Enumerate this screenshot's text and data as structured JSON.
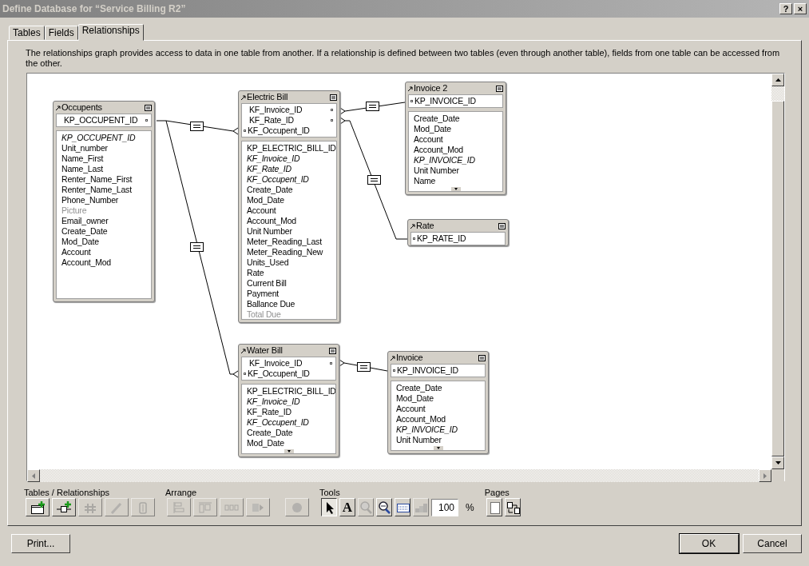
{
  "window": {
    "title": "Define Database for “Service Billing R2”",
    "help_button": "?",
    "close_button": "×"
  },
  "tabs": [
    {
      "label": "Tables",
      "selected": false
    },
    {
      "label": "Fields",
      "selected": false
    },
    {
      "label": "Relationships",
      "selected": true
    }
  ],
  "description": "The relationships graph provides access to data in one table from another. If a relationship is defined between two tables (even through another table), fields from one table can be accessed from the other.",
  "tables": [
    {
      "name": "Occupents",
      "keys": [
        {
          "name": "KP_OCCUPENT_ID",
          "kind": "right-dot"
        }
      ],
      "fields": [
        {
          "name": "KP_OCCUPENT_ID",
          "kind": "italic"
        },
        {
          "name": "Unit_number",
          "kind": "normal"
        },
        {
          "name": "Name_First",
          "kind": "normal"
        },
        {
          "name": "Name_Last",
          "kind": "normal"
        },
        {
          "name": "Renter_Name_First",
          "kind": "normal"
        },
        {
          "name": "Renter_Name_Last",
          "kind": "normal"
        },
        {
          "name": "Phone_Number",
          "kind": "normal"
        },
        {
          "name": "Picture",
          "kind": "dim"
        },
        {
          "name": "Email_owner",
          "kind": "normal"
        },
        {
          "name": "Create_Date",
          "kind": "normal"
        },
        {
          "name": "Mod_Date",
          "kind": "normal"
        },
        {
          "name": "Account",
          "kind": "normal"
        },
        {
          "name": "Account_Mod",
          "kind": "normal"
        }
      ]
    },
    {
      "name": "Electric Bill",
      "keys": [
        {
          "name": "KF_Invoice_ID",
          "kind": "right-dot"
        },
        {
          "name": "KF_Rate_ID",
          "kind": "right-dot"
        },
        {
          "name": "KF_Occupent_ID",
          "kind": "left-dot"
        }
      ],
      "fields": [
        {
          "name": "KP_ELECTRIC_BILL_ID",
          "kind": "normal"
        },
        {
          "name": "KF_Invoice_ID",
          "kind": "italic"
        },
        {
          "name": "KF_Rate_ID",
          "kind": "italic"
        },
        {
          "name": "KF_Occupent_ID",
          "kind": "italic"
        },
        {
          "name": "Create_Date",
          "kind": "normal"
        },
        {
          "name": "Mod_Date",
          "kind": "normal"
        },
        {
          "name": "Account",
          "kind": "normal"
        },
        {
          "name": "Account_Mod",
          "kind": "normal"
        },
        {
          "name": "Unit Number",
          "kind": "normal"
        },
        {
          "name": "Meter_Reading_Last",
          "kind": "normal"
        },
        {
          "name": "Meter_Reading_New",
          "kind": "normal"
        },
        {
          "name": "Units_Used",
          "kind": "normal"
        },
        {
          "name": "Rate",
          "kind": "normal"
        },
        {
          "name": "Current Bill",
          "kind": "normal"
        },
        {
          "name": "Payment",
          "kind": "normal"
        },
        {
          "name": "Ballance Due",
          "kind": "normal"
        },
        {
          "name": "Total Due",
          "kind": "dim"
        }
      ]
    },
    {
      "name": "Invoice 2",
      "keys": [
        {
          "name": "KP_INVOICE_ID",
          "kind": "left-dot"
        }
      ],
      "truncated": true,
      "fields": [
        {
          "name": "Create_Date",
          "kind": "normal"
        },
        {
          "name": "Mod_Date",
          "kind": "normal"
        },
        {
          "name": "Account",
          "kind": "normal"
        },
        {
          "name": "Account_Mod",
          "kind": "normal"
        },
        {
          "name": "KP_INVOICE_ID",
          "kind": "italic"
        },
        {
          "name": "Unit Number",
          "kind": "normal"
        },
        {
          "name": "Name",
          "kind": "normal"
        }
      ]
    },
    {
      "name": "Rate",
      "keys": [
        {
          "name": "KP_RATE_ID",
          "kind": "left-dot"
        }
      ]
    },
    {
      "name": "Water Bill",
      "keys": [
        {
          "name": "KF_Invoice_ID",
          "kind": "right-dot"
        },
        {
          "name": "KF_Occupent_ID",
          "kind": "left-dot"
        }
      ],
      "truncated": true,
      "fields": [
        {
          "name": "KP_ELECTRIC_BILL_ID",
          "kind": "normal"
        },
        {
          "name": "KF_Invoice_ID",
          "kind": "italic"
        },
        {
          "name": "KF_Rate_ID",
          "kind": "normal"
        },
        {
          "name": "KF_Occupent_ID",
          "kind": "italic"
        },
        {
          "name": "Create_Date",
          "kind": "normal"
        },
        {
          "name": "Mod_Date",
          "kind": "normal"
        }
      ]
    },
    {
      "name": "Invoice",
      "keys": [
        {
          "name": "KP_INVOICE_ID",
          "kind": "left-dot"
        }
      ],
      "truncated": true,
      "fields": [
        {
          "name": "Create_Date",
          "kind": "normal"
        },
        {
          "name": "Mod_Date",
          "kind": "normal"
        },
        {
          "name": "Account",
          "kind": "normal"
        },
        {
          "name": "Account_Mod",
          "kind": "normal"
        },
        {
          "name": "KP_INVOICE_ID",
          "kind": "italic"
        },
        {
          "name": "Unit Number",
          "kind": "normal"
        }
      ]
    }
  ],
  "toolbar": [
    {
      "label": "Tables / Relationships",
      "buttons": [
        {
          "kind": "new-table",
          "disabled": false,
          "selected": false
        },
        {
          "kind": "new-relationship",
          "disabled": false,
          "selected": false
        },
        {
          "kind": "duplicate",
          "disabled": true,
          "selected": false
        },
        {
          "kind": "edit",
          "disabled": true,
          "selected": false
        },
        {
          "kind": "delete",
          "disabled": true,
          "selected": false
        }
      ]
    },
    {
      "label": "Arrange",
      "buttons": [
        {
          "kind": "align-left",
          "disabled": true,
          "selected": false
        },
        {
          "kind": "align-top",
          "disabled": true,
          "selected": false
        },
        {
          "kind": "distribute",
          "disabled": true,
          "selected": false
        },
        {
          "kind": "resize",
          "disabled": true,
          "selected": false
        },
        {
          "kind": "color",
          "disabled": true,
          "selected": false
        }
      ]
    },
    {
      "label": "Tools",
      "buttons": [
        {
          "kind": "pointer",
          "disabled": false,
          "selected": true
        },
        {
          "kind": "text",
          "label": "A",
          "disabled": false,
          "selected": false
        },
        {
          "kind": "zoom-in",
          "disabled": true,
          "selected": false
        },
        {
          "kind": "zoom-out",
          "disabled": false,
          "selected": false
        },
        {
          "kind": "page-breaks",
          "disabled": false,
          "selected": false
        },
        {
          "kind": "collapse",
          "disabled": true,
          "selected": false
        }
      ],
      "zoom": {
        "value": "100",
        "unit": "%"
      }
    },
    {
      "label": "Pages",
      "buttons": [
        {
          "kind": "page-setup",
          "disabled": false,
          "selected": false
        },
        {
          "kind": "page-order",
          "disabled": false,
          "selected": false
        }
      ]
    }
  ],
  "footer": {
    "print_button": "Print...",
    "ok_button": "OK",
    "cancel_button": "Cancel"
  }
}
